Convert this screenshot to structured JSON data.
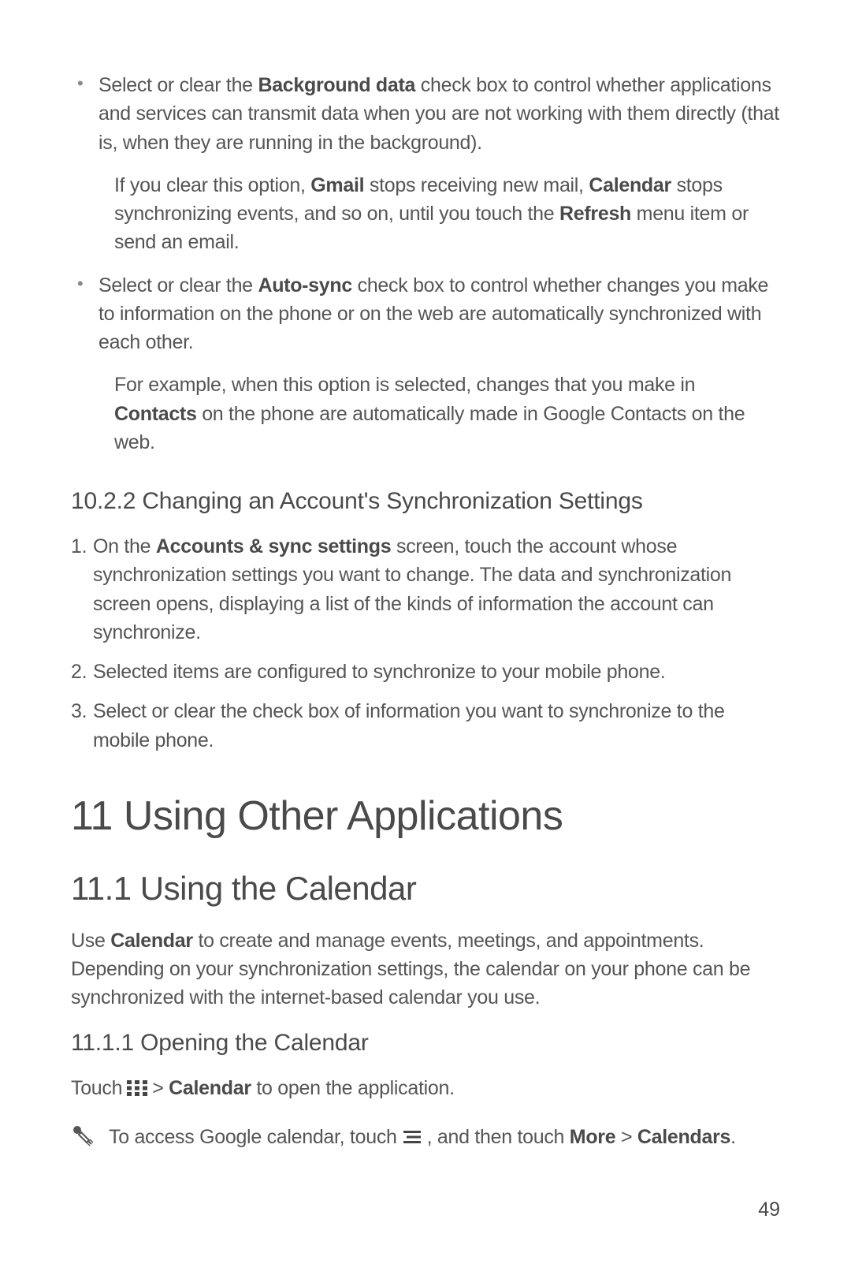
{
  "bullet1": {
    "part1": "Select or clear the ",
    "bold1": "Background data",
    "part2": " check box to control whether applications and services can transmit data when you are not working with them directly (that is, when they are running in the background).",
    "sub_part1": "If you clear this option, ",
    "sub_bold1": "Gmail",
    "sub_part2": " stops receiving new mail, ",
    "sub_bold2": "Calendar",
    "sub_part3": " stops synchronizing events, and so on, until you touch the ",
    "sub_bold3": "Refresh",
    "sub_part4": " menu item or send an email."
  },
  "bullet2": {
    "part1": "Select or clear the ",
    "bold1": "Auto-sync",
    "part2": " check box to control whether changes you make to information on the phone or on the web are automatically synchronized with each other.",
    "sub_part1": "For example, when this option is selected, changes that you make in ",
    "sub_bold1": "Contacts",
    "sub_part2": " on the phone are automatically made in Google Contacts on the web."
  },
  "sec_10_2_2": {
    "heading": "10.2.2  Changing an Account's Synchronization Settings",
    "step1_num": "1.",
    "step1_p1": "On the ",
    "step1_b1": "Accounts & sync settings",
    "step1_p2": " screen, touch the account whose synchronization settings you want to change. The data and synchronization screen opens, displaying a list of the kinds of information the account can synchronize.",
    "step2_num": "2.",
    "step2_text": "Selected items are configured to synchronize to your mobile phone.",
    "step3_num": "3.",
    "step3_text": "Select or clear the check box of information you want to synchronize to the mobile phone."
  },
  "sec_11": {
    "heading": "11  Using Other Applications"
  },
  "sec_11_1": {
    "heading": "11.1  Using the Calendar",
    "para_p1": "Use ",
    "para_b1": "Calendar",
    "para_p2": " to create and manage events, meetings, and appointments. Depending on your synchronization settings, the calendar on your phone can be synchronized with the internet-based calendar you use."
  },
  "sec_11_1_1": {
    "heading": "11.1.1  Opening the Calendar",
    "touch_p1": "Touch",
    "touch_p2": " > ",
    "touch_b1": "Calendar",
    "touch_p3": " to open the application.",
    "tip_p1": "To access Google calendar,  touch",
    "tip_p2": ", and then touch ",
    "tip_b1": "More",
    "tip_p3": " > ",
    "tip_b2": "Calendars",
    "tip_p4": "."
  },
  "page_number": "49"
}
